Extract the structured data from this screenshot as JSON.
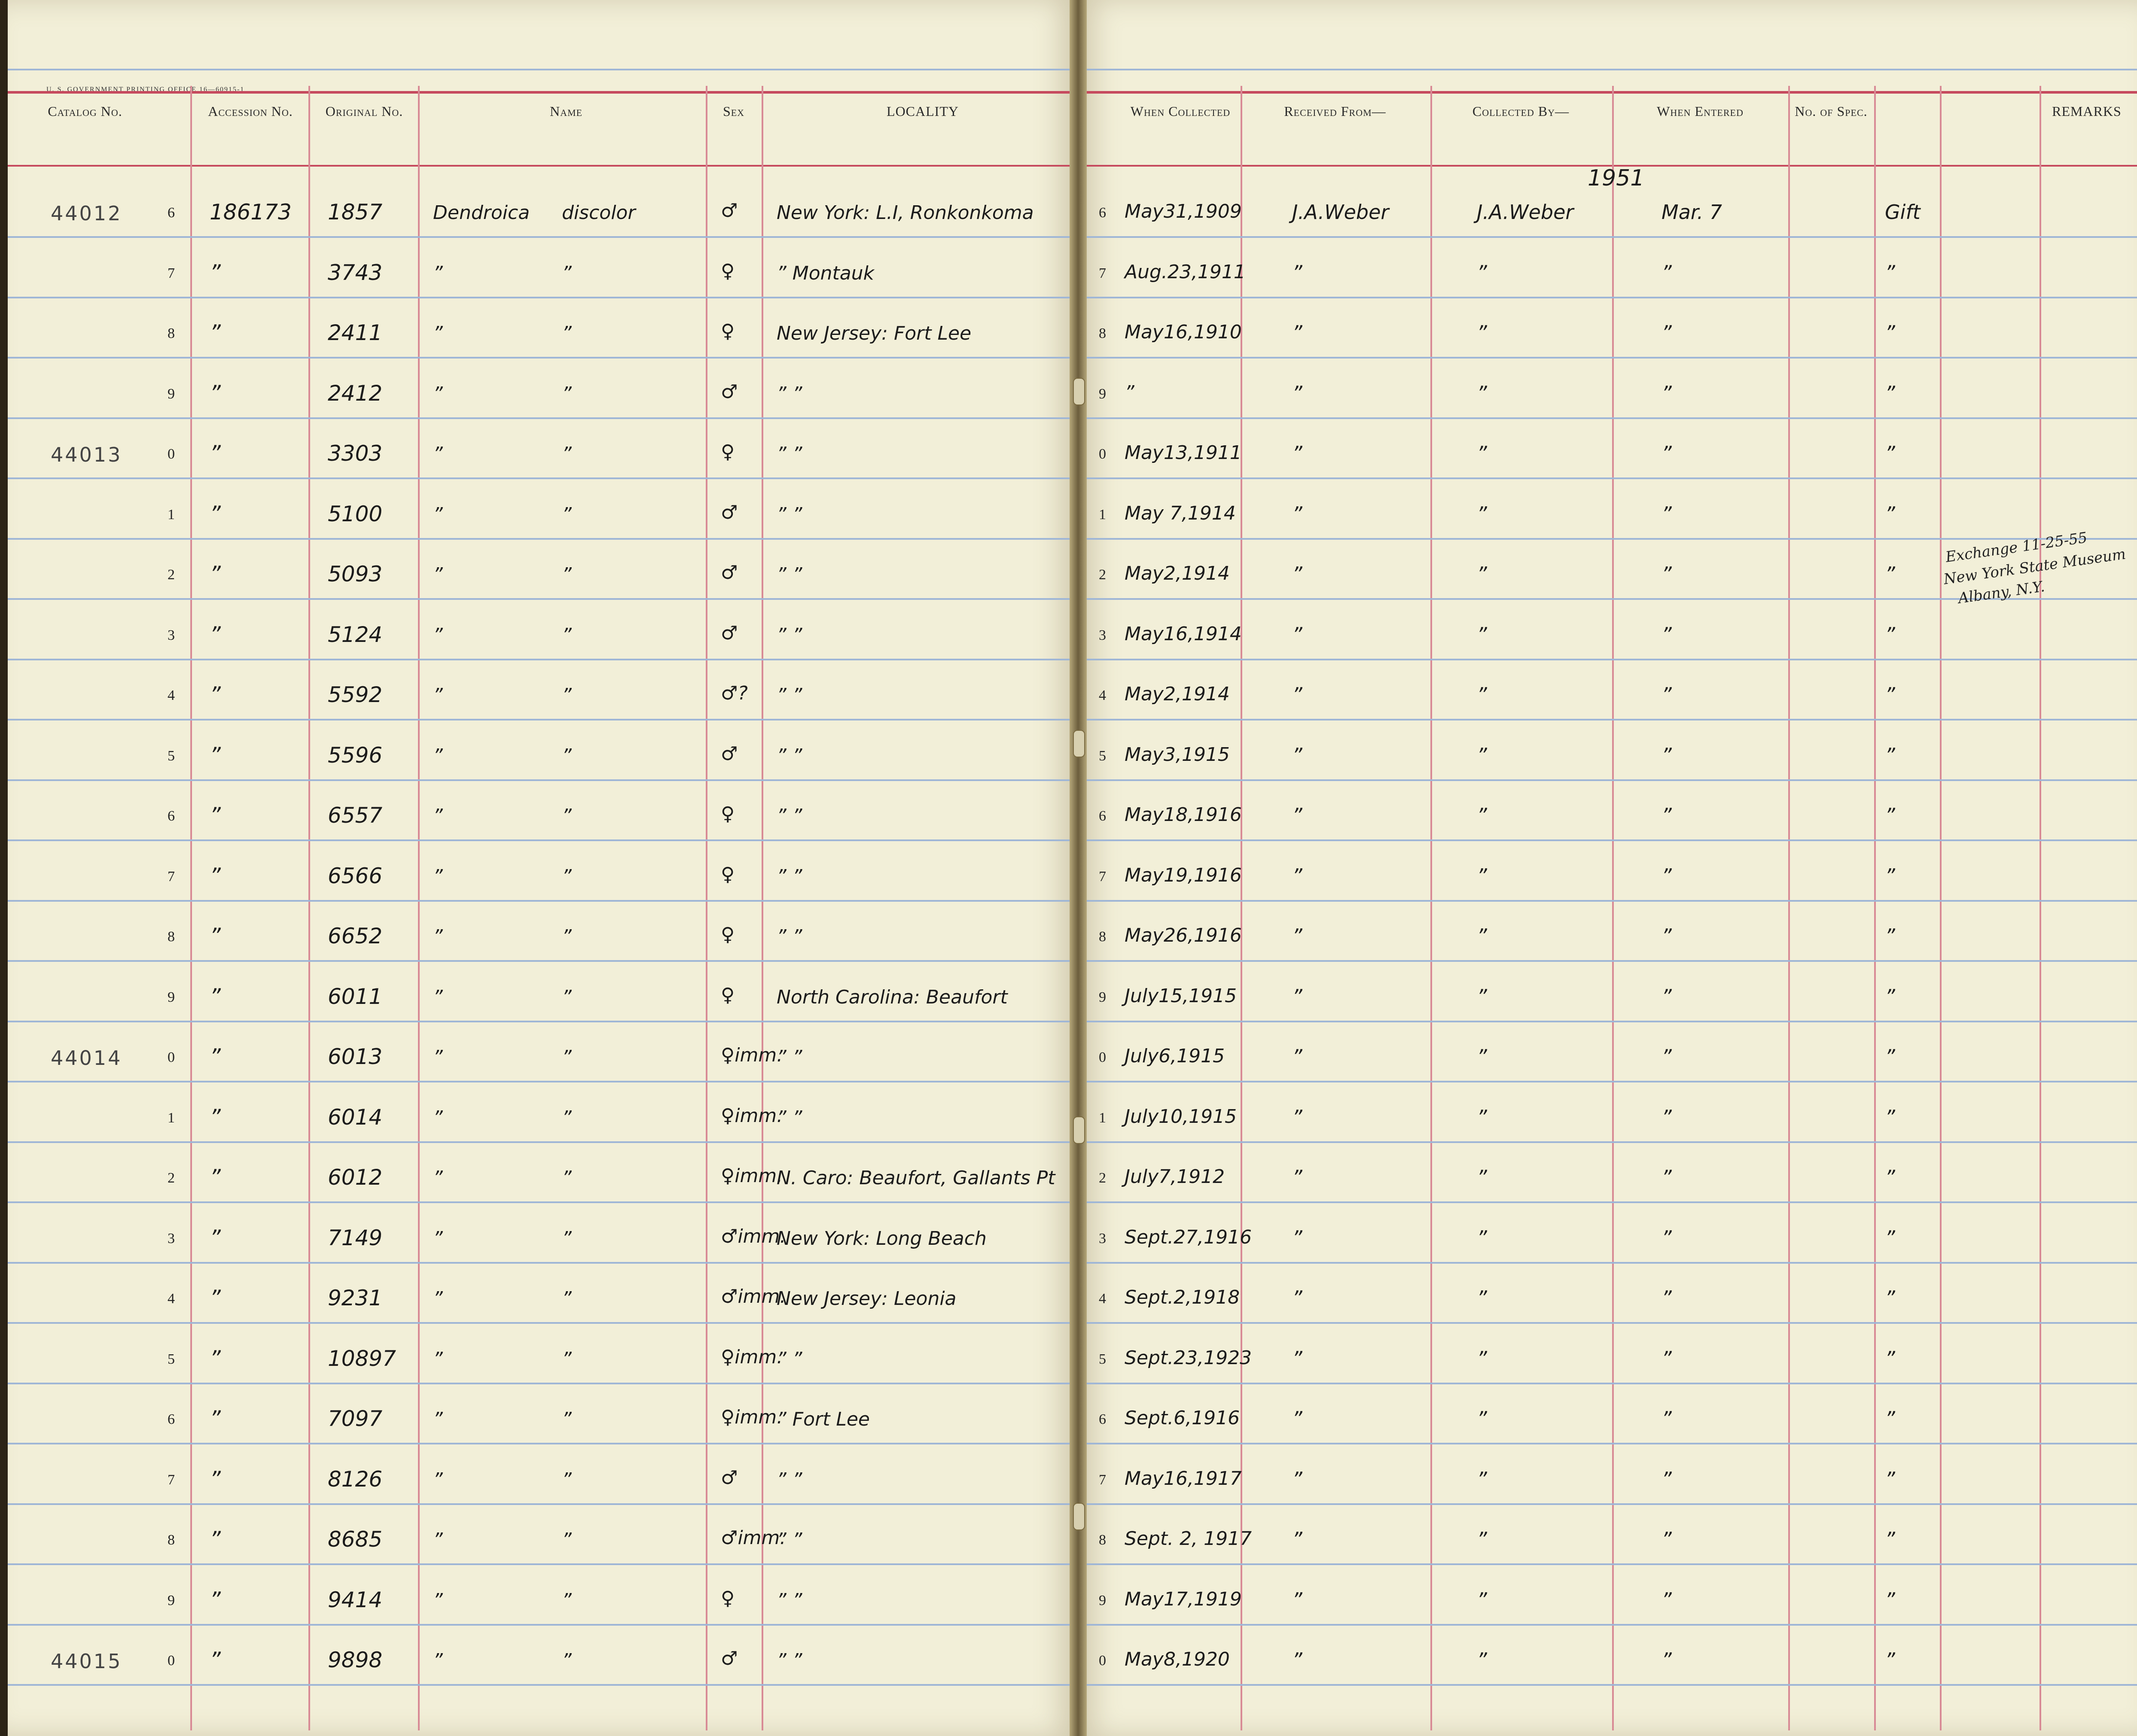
{
  "printer_line": "U. S. GOVERNMENT PRINTING OFFICE    16—60915-1",
  "headers_left": {
    "catalog": "Catalog No.",
    "accession": "Accession No.",
    "original": "Original No.",
    "name": "Name",
    "sex": "Sex",
    "locality": "LOCALITY"
  },
  "headers_right": {
    "when_collected": "When Collected",
    "received_from": "Received From—",
    "collected_by": "Collected By—",
    "when_entered": "When Entered",
    "no_spec": "No. of Spec.",
    "remarks": "REMARKS"
  },
  "year_entered": "1951",
  "catalog_groups": [
    "44012",
    "44013",
    "44014",
    "44015"
  ],
  "rows": [
    {
      "n": "6",
      "acc": "186173",
      "orig": "1857",
      "name1": "Dendroica",
      "name2": "discolor",
      "sex": "♂",
      "locality": "New York: L.I, Ronkonkoma",
      "rn": "6",
      "date": "May31,1909",
      "recv": "J.A.Weber",
      "coll": "J.A.Weber",
      "entered": "Mar. 7",
      "spec": "Gift"
    },
    {
      "n": "7",
      "acc": "”",
      "orig": "3743",
      "name1": "”",
      "name2": "”",
      "sex": "♀",
      "locality": "”      Montauk",
      "rn": "7",
      "date": "Aug.23,1911",
      "recv": "”",
      "coll": "”",
      "entered": "”",
      "spec": "”"
    },
    {
      "n": "8",
      "acc": "”",
      "orig": "2411",
      "name1": "”",
      "name2": "”",
      "sex": "♀",
      "locality": "New Jersey: Fort Lee",
      "rn": "8",
      "date": "May16,1910",
      "recv": "”",
      "coll": "”",
      "entered": "”",
      "spec": "”"
    },
    {
      "n": "9",
      "acc": "”",
      "orig": "2412",
      "name1": "”",
      "name2": "”",
      "sex": "♂",
      "locality": "”         ”",
      "rn": "9",
      "date": "”",
      "recv": "”",
      "coll": "”",
      "entered": "”",
      "spec": "”"
    },
    {
      "n": "0",
      "acc": "”",
      "orig": "3303",
      "name1": "”",
      "name2": "”",
      "sex": "♀",
      "locality": "”         ”",
      "rn": "0",
      "date": "May13,1911",
      "recv": "”",
      "coll": "”",
      "entered": "”",
      "spec": "”"
    },
    {
      "n": "1",
      "acc": "”",
      "orig": "5100",
      "name1": "”",
      "name2": "”",
      "sex": "♂",
      "locality": "”         ”",
      "rn": "1",
      "date": "May 7,1914",
      "recv": "”",
      "coll": "”",
      "entered": "”",
      "spec": "”"
    },
    {
      "n": "2",
      "acc": "”",
      "orig": "5093",
      "name1": "”",
      "name2": "”",
      "sex": "♂",
      "locality": "”         ”",
      "rn": "2",
      "date": "May2,1914",
      "recv": "”",
      "coll": "”",
      "entered": "”",
      "spec": "”"
    },
    {
      "n": "3",
      "acc": "”",
      "orig": "5124",
      "name1": "”",
      "name2": "”",
      "sex": "♂",
      "locality": "”         ”",
      "rn": "3",
      "date": "May16,1914",
      "recv": "”",
      "coll": "”",
      "entered": "”",
      "spec": "”"
    },
    {
      "n": "4",
      "acc": "”",
      "orig": "5592",
      "name1": "”",
      "name2": "”",
      "sex": "♂?",
      "locality": "”         ”",
      "rn": "4",
      "date": "May2,1914",
      "recv": "”",
      "coll": "”",
      "entered": "”",
      "spec": "”"
    },
    {
      "n": "5",
      "acc": "”",
      "orig": "5596",
      "name1": "”",
      "name2": "”",
      "sex": "♂",
      "locality": "”         ”",
      "rn": "5",
      "date": "May3,1915",
      "recv": "”",
      "coll": "”",
      "entered": "”",
      "spec": "”"
    },
    {
      "n": "6",
      "acc": "”",
      "orig": "6557",
      "name1": "”",
      "name2": "”",
      "sex": "♀",
      "locality": "”         ”",
      "rn": "6",
      "date": "May18,1916",
      "recv": "”",
      "coll": "”",
      "entered": "”",
      "spec": "”"
    },
    {
      "n": "7",
      "acc": "”",
      "orig": "6566",
      "name1": "”",
      "name2": "”",
      "sex": "♀",
      "locality": "”         ”",
      "rn": "7",
      "date": "May19,1916",
      "recv": "”",
      "coll": "”",
      "entered": "”",
      "spec": "”"
    },
    {
      "n": "8",
      "acc": "”",
      "orig": "6652",
      "name1": "”",
      "name2": "”",
      "sex": "♀",
      "locality": "”         ”",
      "rn": "8",
      "date": "May26,1916",
      "recv": "”",
      "coll": "”",
      "entered": "”",
      "spec": "”"
    },
    {
      "n": "9",
      "acc": "”",
      "orig": "6011",
      "name1": "”",
      "name2": "”",
      "sex": "♀",
      "locality": "North Carolina: Beaufort",
      "rn": "9",
      "date": "July15,1915",
      "recv": "”",
      "coll": "”",
      "entered": "”",
      "spec": "”"
    },
    {
      "n": "0",
      "acc": "”",
      "orig": "6013",
      "name1": "”",
      "name2": "”",
      "sex": "♀imm.",
      "locality": "”         ”",
      "rn": "0",
      "date": "July6,1915",
      "recv": "”",
      "coll": "”",
      "entered": "”",
      "spec": "”"
    },
    {
      "n": "1",
      "acc": "”",
      "orig": "6014",
      "name1": "”",
      "name2": "”",
      "sex": "♀imm.",
      "locality": "”         ”",
      "rn": "1",
      "date": "July10,1915",
      "recv": "”",
      "coll": "”",
      "entered": "”",
      "spec": "”"
    },
    {
      "n": "2",
      "acc": "”",
      "orig": "6012",
      "name1": "”",
      "name2": "”",
      "sex": "♀imm.",
      "locality": "N. Caro: Beaufort, Gallants Pt",
      "rn": "2",
      "date": "July7,1912",
      "recv": "”",
      "coll": "”",
      "entered": "”",
      "spec": "”"
    },
    {
      "n": "3",
      "acc": "”",
      "orig": "7149",
      "name1": "”",
      "name2": "”",
      "sex": "♂imm.",
      "locality": "New York: Long Beach",
      "rn": "3",
      "date": "Sept.27,1916",
      "recv": "”",
      "coll": "”",
      "entered": "”",
      "spec": "”"
    },
    {
      "n": "4",
      "acc": "”",
      "orig": "9231",
      "name1": "”",
      "name2": "”",
      "sex": "♂imm.",
      "locality": "New Jersey: Leonia",
      "rn": "4",
      "date": "Sept.2,1918",
      "recv": "”",
      "coll": "”",
      "entered": "”",
      "spec": "”"
    },
    {
      "n": "5",
      "acc": "”",
      "orig": "10897",
      "name1": "”",
      "name2": "”",
      "sex": "♀imm.",
      "locality": "”         ”",
      "rn": "5",
      "date": "Sept.23,1923",
      "recv": "”",
      "coll": "”",
      "entered": "”",
      "spec": "”"
    },
    {
      "n": "6",
      "acc": "”",
      "orig": "7097",
      "name1": "”",
      "name2": "”",
      "sex": "♀imm.",
      "locality": "”      Fort Lee",
      "rn": "6",
      "date": "Sept.6,1916",
      "recv": "”",
      "coll": "”",
      "entered": "”",
      "spec": "”"
    },
    {
      "n": "7",
      "acc": "”",
      "orig": "8126",
      "name1": "”",
      "name2": "”",
      "sex": "♂",
      "locality": "”         ”",
      "rn": "7",
      "date": "May16,1917",
      "recv": "”",
      "coll": "”",
      "entered": "”",
      "spec": "”"
    },
    {
      "n": "8",
      "acc": "”",
      "orig": "8685",
      "name1": "”",
      "name2": "”",
      "sex": "♂imm.",
      "locality": "”         ”",
      "rn": "8",
      "date": "Sept. 2, 1917",
      "recv": "”",
      "coll": "”",
      "entered": "”",
      "spec": "”"
    },
    {
      "n": "9",
      "acc": "”",
      "orig": "9414",
      "name1": "”",
      "name2": "”",
      "sex": "♀",
      "locality": "”         ”",
      "rn": "9",
      "date": "May17,1919",
      "recv": "”",
      "coll": "”",
      "entered": "”",
      "spec": "”"
    },
    {
      "n": "0",
      "acc": "”",
      "orig": "9898",
      "name1": "”",
      "name2": "”",
      "sex": "♂",
      "locality": "”         ”",
      "rn": "0",
      "date": "May8,1920",
      "recv": "”",
      "coll": "”",
      "entered": "”",
      "spec": "”"
    }
  ],
  "remark": {
    "line1": "Exchange 11-25-55",
    "line2": "New York State Museum",
    "line3": "Albany, N.Y."
  }
}
